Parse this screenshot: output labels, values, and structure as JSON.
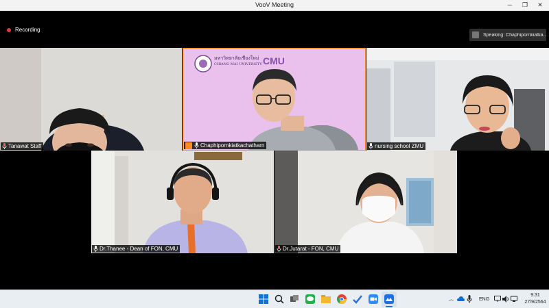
{
  "window": {
    "title": "VooV Meeting"
  },
  "recording": {
    "label": "Recording"
  },
  "speaking": {
    "label": "Speaking: Chaphipornkiatka..."
  },
  "tiles": [
    {
      "name": "Tanawat Staff"
    },
    {
      "name": "Chaphipornkiatkachatharn",
      "banner": "มหาวิทยาลัยเชียงใหม่",
      "banner_sub": "CHIANG MAI UNIVERSITY",
      "logo_text": "CMU"
    },
    {
      "name": "nursing school ZMU"
    },
    {
      "name": "Dr.Thanee - Dean of FON, CMU"
    },
    {
      "name": "Dr.Jutarat - FON, CMU"
    }
  ],
  "taskbar": {
    "lang": "ENG",
    "time": "9:31",
    "date": "27/9/2564"
  },
  "colors": {
    "accent": "#ff8a1e",
    "recording": "#e2373a",
    "banner_bg": "#e9c1ec"
  }
}
